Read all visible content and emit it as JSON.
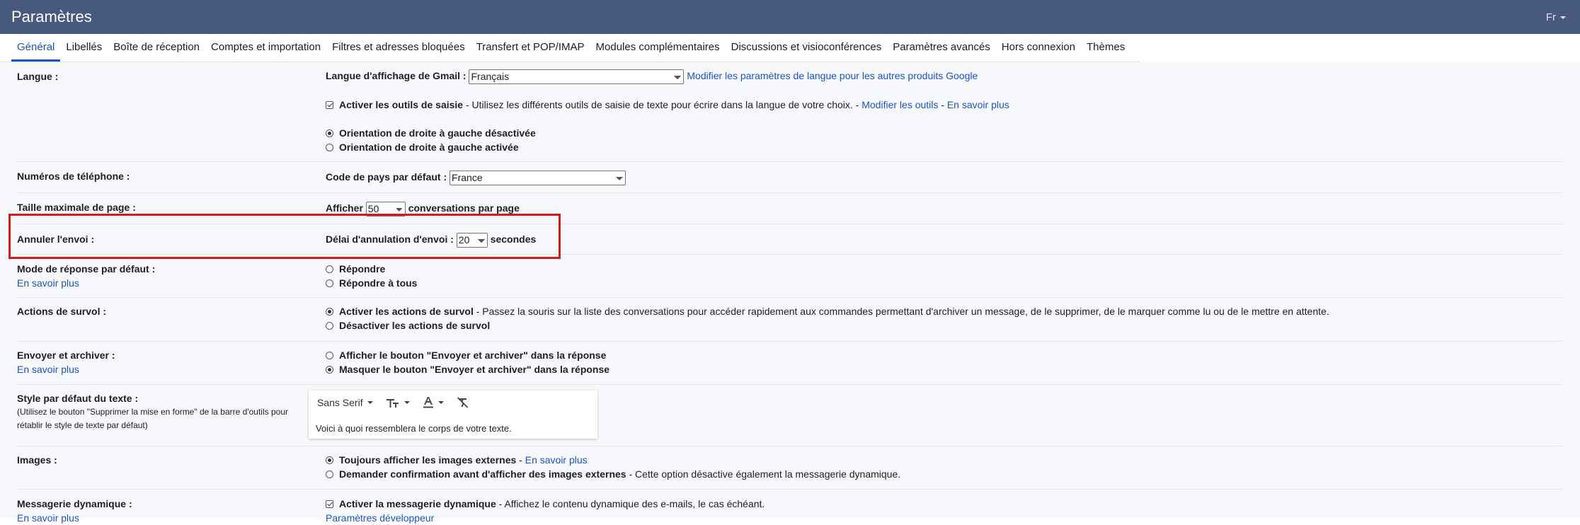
{
  "header": {
    "title": "Paramètres",
    "lang_toggle": "Fr"
  },
  "tabs": [
    {
      "label": "Général",
      "active": true
    },
    {
      "label": "Libellés"
    },
    {
      "label": "Boîte de réception"
    },
    {
      "label": "Comptes et importation"
    },
    {
      "label": "Filtres et adresses bloquées"
    },
    {
      "label": "Transfert et POP/IMAP"
    },
    {
      "label": "Modules complémentaires"
    },
    {
      "label": "Discussions et visioconférences"
    },
    {
      "label": "Paramètres avancés"
    },
    {
      "label": "Hors connexion"
    },
    {
      "label": "Thèmes"
    }
  ],
  "settings": {
    "language": {
      "label": "Langue :",
      "display_label": "Langue d'affichage de Gmail :",
      "display_value": "Français",
      "other_link": "Modifier les paramètres de langue pour les autres produits Google",
      "input_tools_label": "Activer les outils de saisie",
      "input_tools_desc": " - Utilisez les différents outils de saisie de texte pour écrire dans la langue de votre choix. - ",
      "input_tools_edit": "Modifier les outils",
      "separator": " - ",
      "learn_more": "En savoir plus",
      "rtl_off": "Orientation de droite à gauche désactivée",
      "rtl_on": "Orientation de droite à gauche activée"
    },
    "phone": {
      "label": "Numéros de téléphone :",
      "country_label": "Code de pays par défaut :",
      "country_value": "France"
    },
    "page_size": {
      "label": "Taille maximale de page :",
      "prefix": "Afficher",
      "value": "50",
      "suffix": "conversations par page"
    },
    "undo_send": {
      "label": "Annuler l'envoi :",
      "prefix": "Délai d'annulation d'envoi :",
      "value": "20",
      "suffix": "secondes"
    },
    "reply_mode": {
      "label": "Mode de réponse par défaut :",
      "learn_more": "En savoir plus",
      "reply": "Répondre",
      "reply_all": "Répondre à tous"
    },
    "hover": {
      "label": "Actions de survol :",
      "enable": "Activer les actions de survol",
      "enable_desc": " - Passez la souris sur la liste des conversations pour accéder rapidement aux commandes permettant d'archiver un message, de le supprimer, de le marquer comme lu ou de le mettre en attente.",
      "disable": "Désactiver les actions de survol"
    },
    "send_archive": {
      "label": "Envoyer et archiver :",
      "learn_more": "En savoir plus",
      "show": "Afficher le bouton \"Envoyer et archiver\" dans la réponse",
      "hide": "Masquer le bouton \"Envoyer et archiver\" dans la réponse"
    },
    "text_style": {
      "label": "Style par défaut du texte :",
      "sub1": "(Utilisez le bouton \"Supprimer la mise en forme\" de la barre d'outils pour",
      "sub2": "rétablir le style de texte par défaut)",
      "font": "Sans Serif",
      "preview": "Voici à quoi ressemblera le corps de votre texte."
    },
    "images": {
      "label": "Images :",
      "always": "Toujours afficher les images externes",
      "always_sep": " - ",
      "learn_more": "En savoir plus",
      "ask": "Demander confirmation avant d'afficher des images externes",
      "ask_desc": " - Cette option désactive également la messagerie dynamique."
    },
    "dynamic": {
      "label": "Messagerie dynamique :",
      "learn_more": "En savoir plus",
      "enable": "Activer la messagerie dynamique",
      "enable_desc": " - Affichez le contenu dynamique des e-mails, le cas échéant.",
      "dev_link": "Paramètres développeur"
    }
  }
}
